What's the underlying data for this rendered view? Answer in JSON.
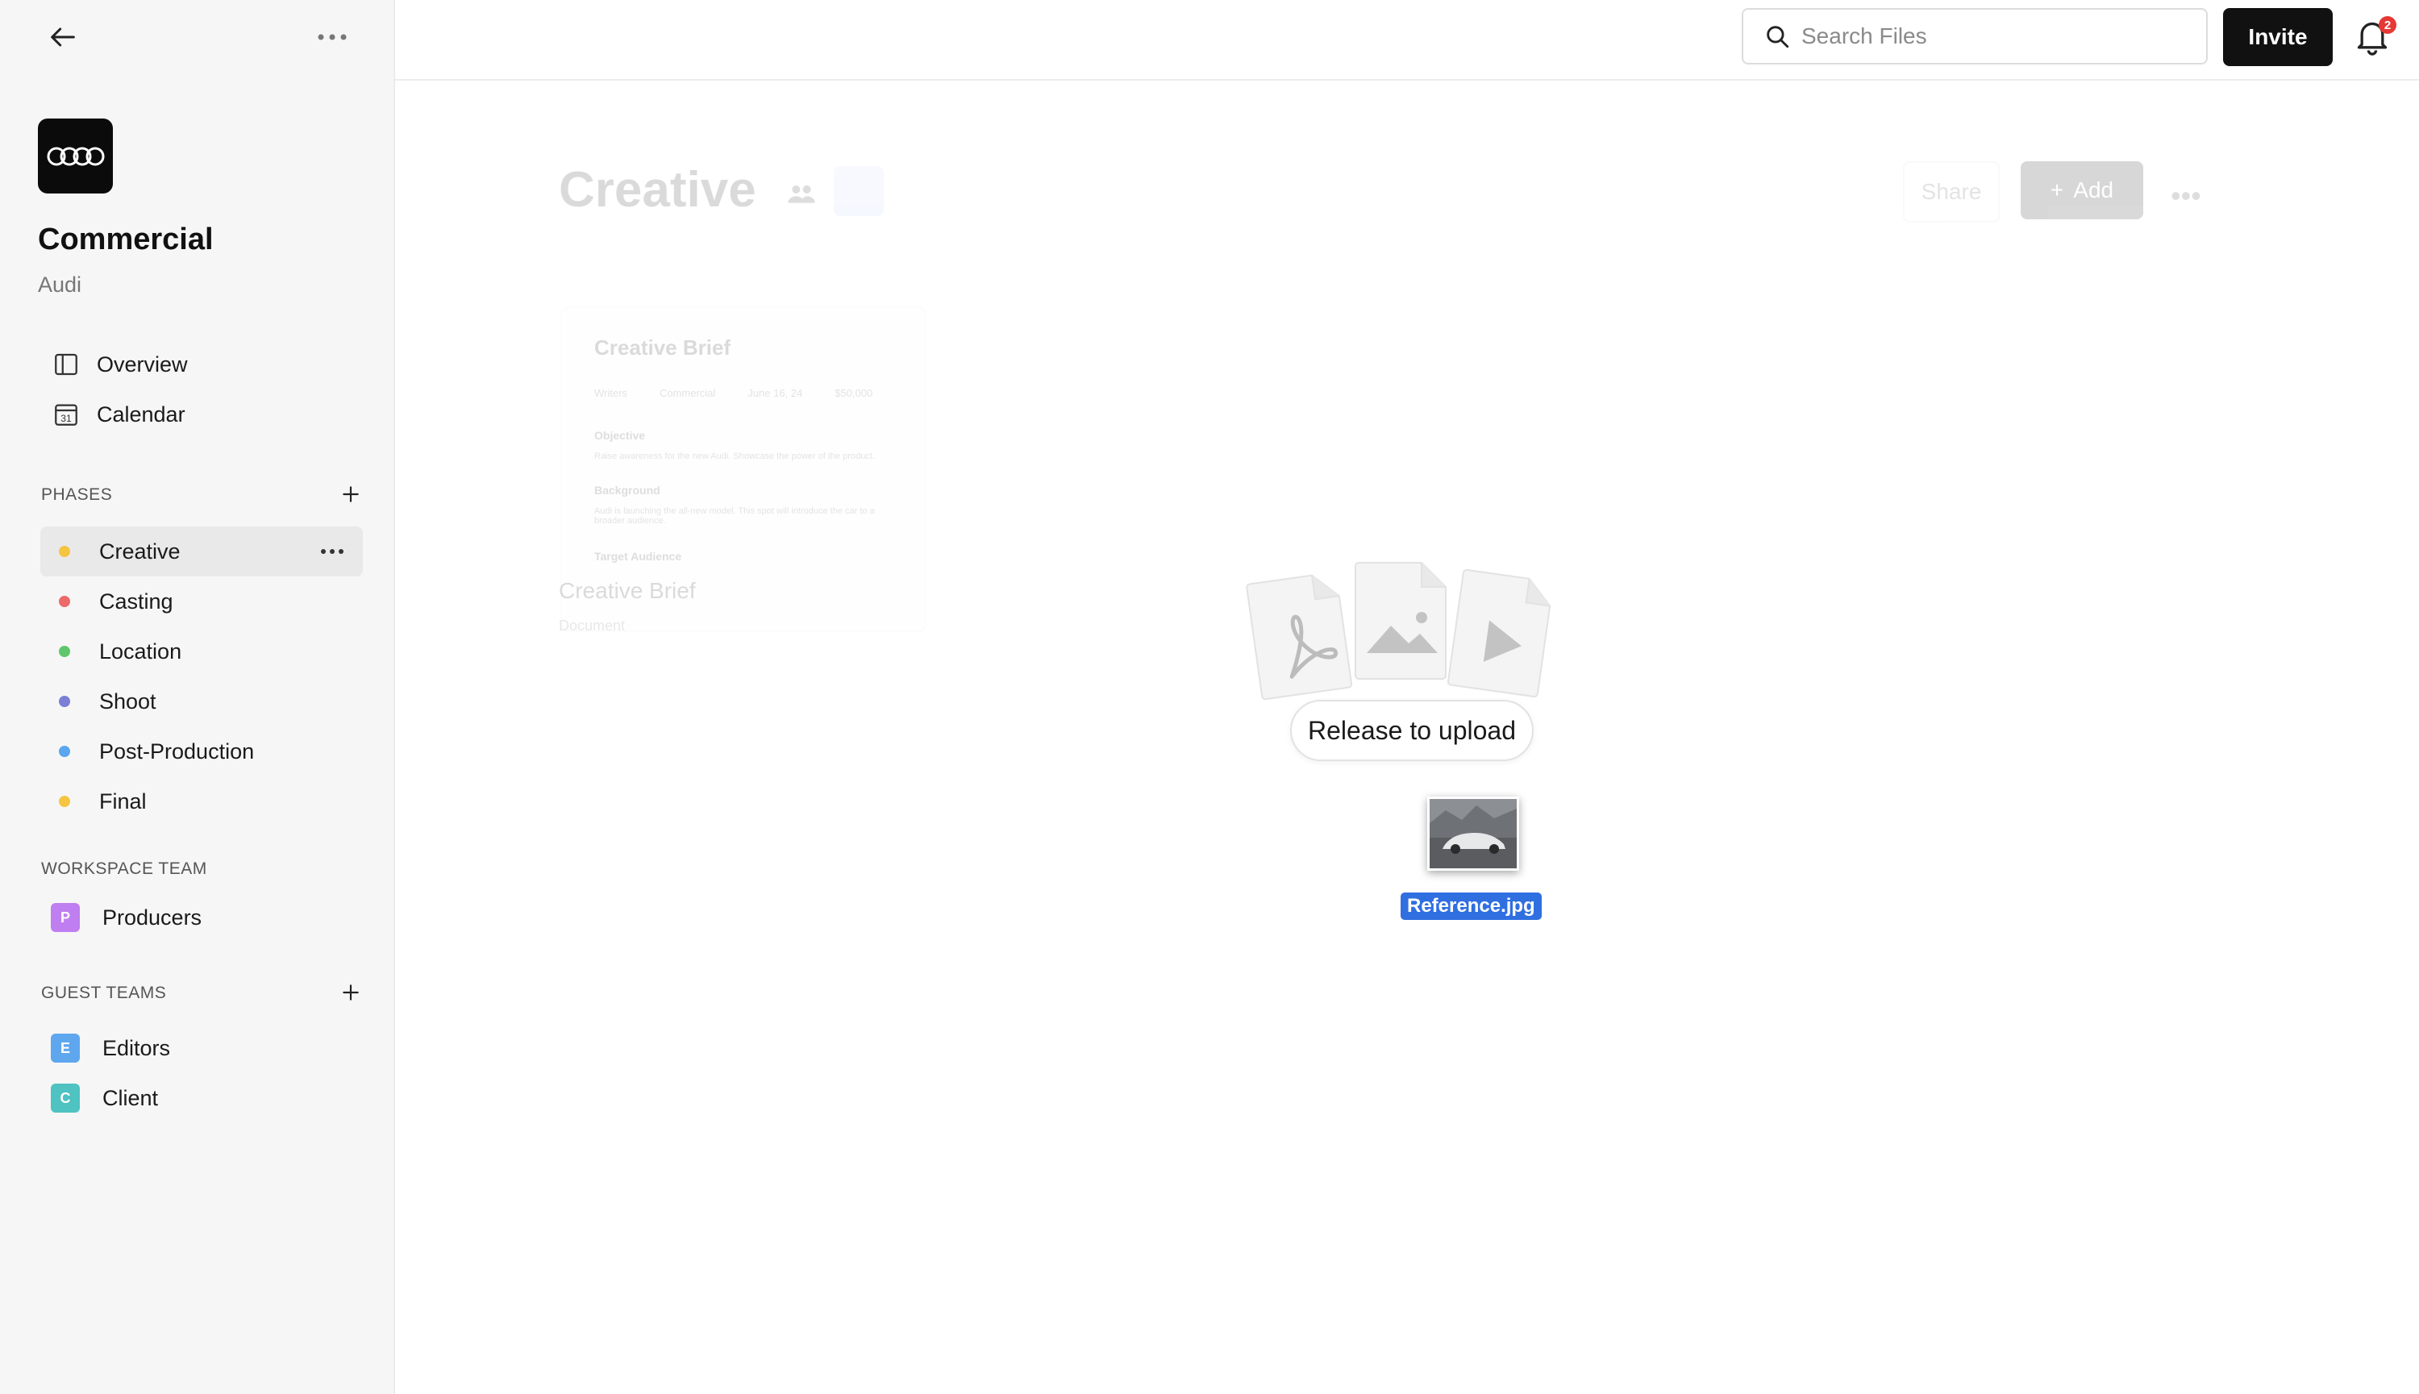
{
  "sidebar": {
    "project_title": "Commercial",
    "client": "Audi",
    "nav": [
      {
        "label": "Overview",
        "icon": "sidebar-panel-icon"
      },
      {
        "label": "Calendar",
        "icon": "calendar-icon"
      }
    ],
    "calendar_day": "31",
    "phases_label": "PHASES",
    "phases": [
      {
        "label": "Creative",
        "color": "#f5c542",
        "active": true
      },
      {
        "label": "Casting",
        "color": "#ec6a6a"
      },
      {
        "label": "Location",
        "color": "#5fc76b"
      },
      {
        "label": "Shoot",
        "color": "#7b7fd6"
      },
      {
        "label": "Post-Production",
        "color": "#5aa6ef"
      },
      {
        "label": "Final",
        "color": "#f5c542"
      }
    ],
    "workspace_team_label": "WORKSPACE TEAM",
    "workspace_teams": [
      {
        "label": "Producers",
        "initial": "P",
        "color": "#c07ff0"
      }
    ],
    "guest_teams_label": "GUEST TEAMS",
    "guest_teams": [
      {
        "label": "Editors",
        "initial": "E",
        "color": "#5ea7ef"
      },
      {
        "label": "Client",
        "initial": "C",
        "color": "#4fc2c2"
      }
    ]
  },
  "header": {
    "search_placeholder": "Search Files",
    "invite_label": "Invite",
    "notification_count": "2"
  },
  "main": {
    "page_title": "Creative",
    "share_label": "Share",
    "add_label": "Add",
    "card": {
      "inner_title": "Creative Brief",
      "meta": [
        "Writers",
        "Commercial",
        "June 16, 24",
        "$50,000"
      ],
      "objective_label": "Objective",
      "objective_text": "Raise awareness for the new Audi. Showcase the power of the product.",
      "background_label": "Background",
      "background_text": "Audi is launching the all-new model. This spot will introduce the car to a broader audience.",
      "target_label": "Target Audience",
      "title": "Creative Brief",
      "subtitle": "Document"
    }
  },
  "drop_overlay": {
    "message": "Release to upload",
    "dragged_file": "Reference.jpg",
    "file_type_icons": [
      "pdf-file-icon",
      "image-file-icon",
      "video-file-icon"
    ]
  }
}
